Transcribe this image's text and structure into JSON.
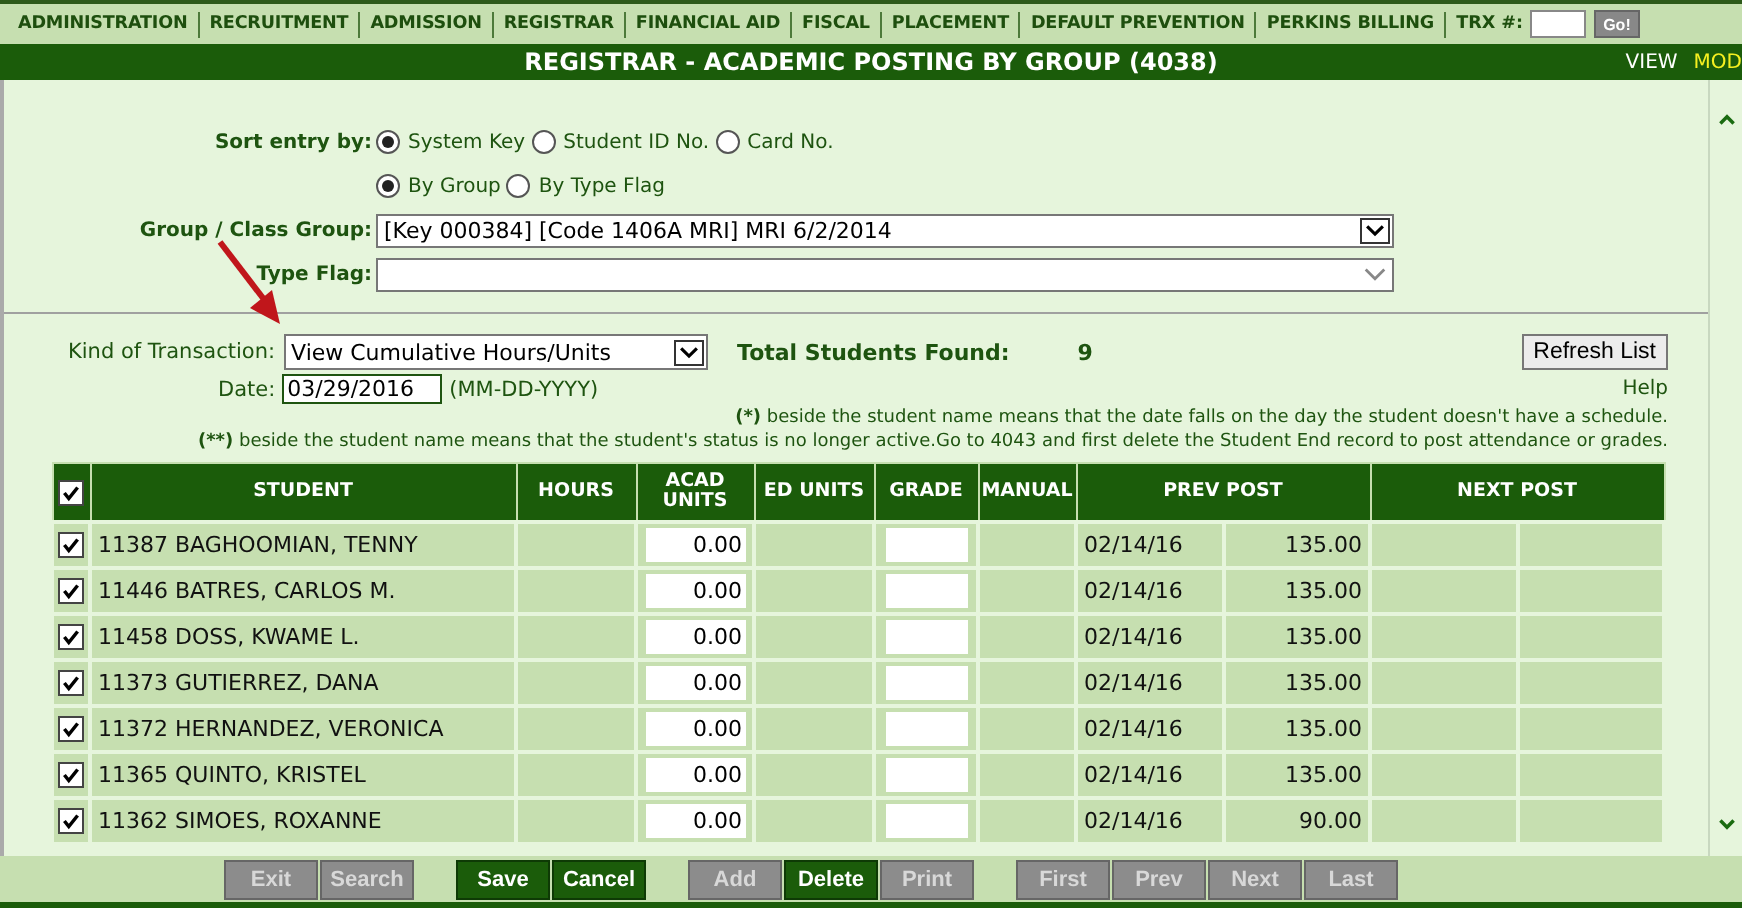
{
  "nav": {
    "items": [
      "ADMINISTRATION",
      "RECRUITMENT",
      "ADMISSION",
      "REGISTRAR",
      "FINANCIAL AID",
      "FISCAL",
      "PLACEMENT",
      "DEFAULT PREVENTION",
      "PERKINS BILLING"
    ],
    "trx_label": "TRX #:",
    "go_button": "Go!"
  },
  "title_bar": {
    "title": "REGISTRAR - ACADEMIC POSTING BY GROUP (4038)",
    "view_label": "VIEW",
    "mode_label": "MOD"
  },
  "sort": {
    "label": "Sort entry by:",
    "options": [
      {
        "label": "System Key",
        "selected": true
      },
      {
        "label": "Student ID No.",
        "selected": false
      },
      {
        "label": "Card No.",
        "selected": false
      }
    ],
    "grouping": [
      {
        "label": "By Group",
        "selected": true
      },
      {
        "label": "By Type Flag",
        "selected": false
      }
    ]
  },
  "group_field": {
    "label": "Group / Class Group:",
    "value": "[Key 000384] [Code 1406A MRI] MRI 6/2/2014"
  },
  "type_flag": {
    "label": "Type Flag:"
  },
  "transaction": {
    "label": "Kind of Transaction:",
    "value": "View Cumulative Hours/Units",
    "total_label": "Total Students Found:",
    "total_value": "9",
    "refresh_button": "Refresh List"
  },
  "date": {
    "label": "Date:",
    "value": "03/29/2016",
    "hint": "(MM-DD-YYYY)",
    "help": "Help"
  },
  "notes": [
    {
      "mark": "(*)",
      "text": "beside the student name means that the date falls on the day the student doesn't have a schedule."
    },
    {
      "mark": "(**)",
      "text": "beside the student name means that the student's status is no longer active.Go to 4043 and first delete the Student End record to post attendance or grades."
    }
  ],
  "table": {
    "select_all_checked": true,
    "columns": [
      "STUDENT",
      "HOURS",
      "ACAD UNITS",
      "ED UNITS",
      "GRADE",
      "MANUAL",
      "PREV POST",
      "NEXT POST"
    ],
    "rows": [
      {
        "checked": true,
        "student": "11387 BAGHOOMIAN, TENNY",
        "acad_units": "0.00",
        "prev_date": "02/14/16",
        "prev_amount": "135.00"
      },
      {
        "checked": true,
        "student": "11446 BATRES, CARLOS  M.",
        "acad_units": "0.00",
        "prev_date": "02/14/16",
        "prev_amount": "135.00"
      },
      {
        "checked": true,
        "student": "11458 DOSS, KWAME  L.",
        "acad_units": "0.00",
        "prev_date": "02/14/16",
        "prev_amount": "135.00"
      },
      {
        "checked": true,
        "student": "11373 GUTIERREZ, DANA",
        "acad_units": "0.00",
        "prev_date": "02/14/16",
        "prev_amount": "135.00"
      },
      {
        "checked": true,
        "student": "11372 HERNANDEZ, VERONICA",
        "acad_units": "0.00",
        "prev_date": "02/14/16",
        "prev_amount": "135.00"
      },
      {
        "checked": true,
        "student": "11365 QUINTO, KRISTEL",
        "acad_units": "0.00",
        "prev_date": "02/14/16",
        "prev_amount": "135.00"
      },
      {
        "checked": true,
        "student": "11362 SIMOES, ROXANNE",
        "acad_units": "0.00",
        "prev_date": "02/14/16",
        "prev_amount": "90.00"
      }
    ]
  },
  "footer": {
    "groups": [
      [
        {
          "label": "Exit",
          "disabled": true
        },
        {
          "label": "Search",
          "disabled": true
        }
      ],
      [
        {
          "label": "Save",
          "disabled": false
        },
        {
          "label": "Cancel",
          "disabled": false
        }
      ],
      [
        {
          "label": "Add",
          "disabled": true
        },
        {
          "label": "Delete",
          "disabled": false
        },
        {
          "label": "Print",
          "disabled": true
        }
      ],
      [
        {
          "label": "First",
          "disabled": true
        },
        {
          "label": "Prev",
          "disabled": true
        },
        {
          "label": "Next",
          "disabled": true
        },
        {
          "label": "Last",
          "disabled": true
        }
      ]
    ]
  }
}
